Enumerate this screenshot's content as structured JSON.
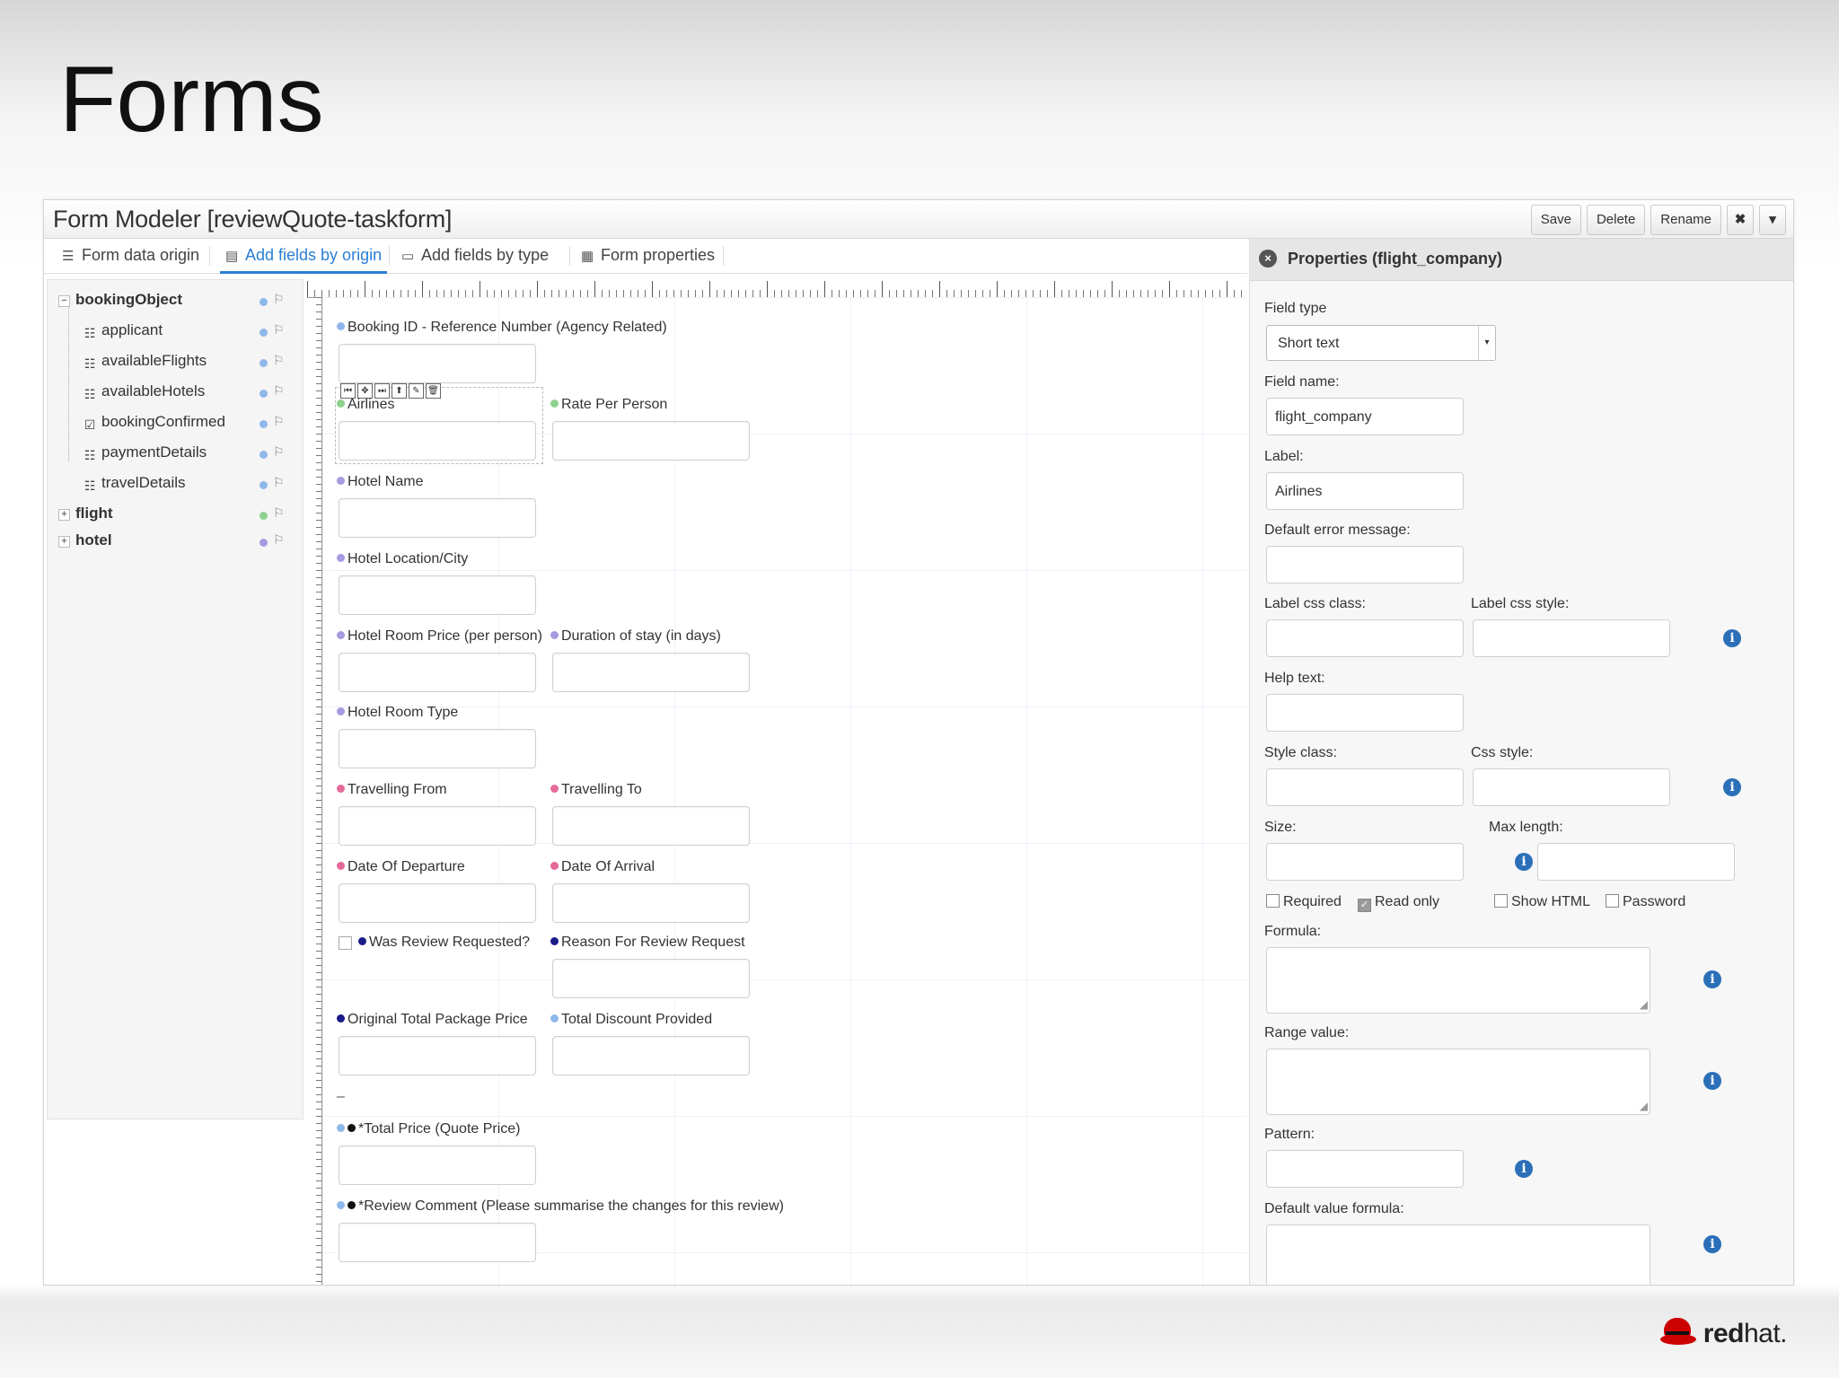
{
  "slide": {
    "title": "Forms"
  },
  "window": {
    "title": "Form Modeler [reviewQuote-taskform]",
    "buttons": {
      "save": "Save",
      "delete": "Delete",
      "rename": "Rename",
      "close": "✖",
      "menu": "▾"
    }
  },
  "tabs": [
    {
      "label": "Form data origin",
      "icon": "database-icon"
    },
    {
      "label": "Add fields by origin",
      "icon": "origin-fields-icon",
      "active": true
    },
    {
      "label": "Add fields by type",
      "icon": "type-fields-icon"
    },
    {
      "label": "Form properties",
      "icon": "properties-icon"
    }
  ],
  "tree": {
    "root": "bookingObject",
    "children": [
      "applicant",
      "availableFlights",
      "availableHotels",
      "bookingConfirmed",
      "paymentDetails",
      "travelDetails"
    ],
    "others": [
      "flight",
      "hotel"
    ]
  },
  "fields": [
    {
      "label": "Booking ID - Reference Number (Agency Related)"
    },
    {
      "label": "Airlines"
    },
    {
      "label": "Rate Per Person"
    },
    {
      "label": "Hotel Name"
    },
    {
      "label": "Hotel Location/City"
    },
    {
      "label": "Hotel Room Price (per person)"
    },
    {
      "label": "Duration of stay (in days)"
    },
    {
      "label": "Hotel Room Type"
    },
    {
      "label": "Travelling From"
    },
    {
      "label": "Travelling To"
    },
    {
      "label": "Date Of Departure"
    },
    {
      "label": "Date Of Arrival"
    },
    {
      "label": "Was Review Requested?"
    },
    {
      "label": "Reason For Review Request"
    },
    {
      "label": "Original Total Package Price"
    },
    {
      "label": "Total Discount Provided"
    },
    {
      "label": "*Total Price (Quote Price)"
    },
    {
      "label": "*Review Comment (Please summarise the changes for this review)"
    }
  ],
  "properties": {
    "title": "Properties (flight_company)",
    "field_type_label": "Field type",
    "field_type_value": "Short text",
    "field_name_label": "Field name:",
    "field_name_value": "flight_company",
    "label_label": "Label:",
    "label_value": "Airlines",
    "default_error_label": "Default error message:",
    "label_css_class": "Label css class:",
    "label_css_style": "Label css style:",
    "help_text": "Help text:",
    "style_class": "Style class:",
    "css_style": "Css style:",
    "size": "Size:",
    "max_length": "Max length:",
    "checkboxes": [
      {
        "label": "Required",
        "checked": false
      },
      {
        "label": "Read only",
        "checked": true
      },
      {
        "label": "Show HTML",
        "checked": false
      },
      {
        "label": "Password",
        "checked": false
      }
    ],
    "formula": "Formula:",
    "range_value": "Range value:",
    "pattern": "Pattern:",
    "default_value_formula": "Default value formula:"
  },
  "footer": {
    "logo_text_bold": "red",
    "logo_text": "hat."
  },
  "colors": {
    "accent": "#2a7fd4",
    "dot_blue": "#8fb8ea",
    "dot_green": "#8fd18f",
    "dot_purple": "#a59be0",
    "dot_pink": "#e46a9a",
    "dot_navy": "#1b1b8a",
    "dot_black": "#111111"
  }
}
